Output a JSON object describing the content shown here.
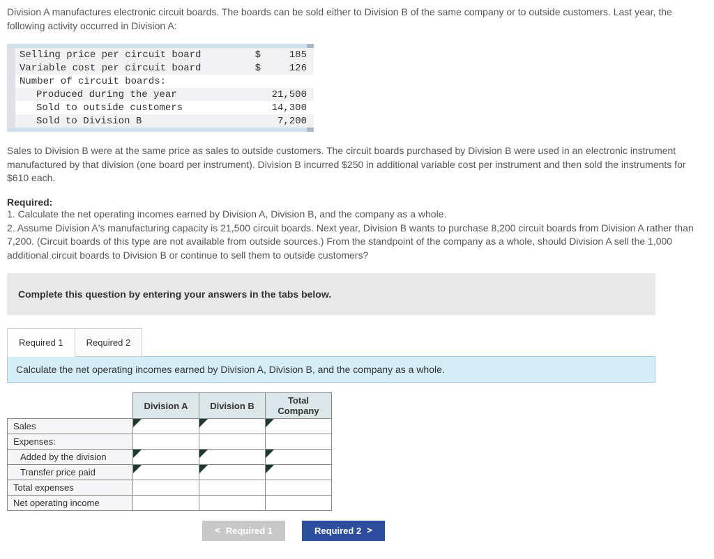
{
  "intro1": "Division A manufactures electronic circuit boards. The boards can be sold either to Division B of the same company or to outside customers. Last year, the following activity occurred in Division A:",
  "table": {
    "r1": {
      "label": "Selling price per circuit board",
      "cur": "$",
      "val": "185"
    },
    "r2": {
      "label": "Variable cost per circuit board",
      "cur": "$",
      "val": "126"
    },
    "r3": {
      "label": "Number of circuit boards:"
    },
    "r4": {
      "label": "Produced during the year",
      "val": "21,500"
    },
    "r5": {
      "label": "Sold to outside customers",
      "val": "14,300"
    },
    "r6": {
      "label": "Sold to Division B",
      "val": "7,200"
    }
  },
  "para2": "Sales to Division B were at the same price as sales to outside customers. The circuit boards purchased by Division B were used in an electronic instrument manufactured by that division (one board per instrument). Division B incurred $250 in additional variable cost per instrument and then sold the instruments for $610 each.",
  "required_label": "Required:",
  "req1": "1. Calculate the net operating incomes earned by Division A, Division B, and the company as a whole.",
  "req2": "2. Assume Division A's manufacturing capacity is 21,500 circuit boards. Next year, Division B wants to purchase 8,200 circuit boards from Division A rather than 7,200. (Circuit boards of this type are not available from outside sources.) From the standpoint of the company as a whole, should Division A sell the 1,000 additional circuit boards to Division B or continue to sell them to outside customers?",
  "instruction": "Complete this question by entering your answers in the tabs below.",
  "tabs": {
    "t1": "Required 1",
    "t2": "Required 2"
  },
  "tab_instruction": "Calculate the net operating incomes earned by Division A, Division B, and the company as a whole.",
  "cols": {
    "c1": "Division A",
    "c2": "Division B",
    "c3": "Total Company"
  },
  "rows": {
    "sales": "Sales",
    "expenses": "Expenses:",
    "added": "Added by the division",
    "transfer": "Transfer price paid",
    "total_exp": "Total expenses",
    "noi": "Net operating income"
  },
  "nav": {
    "prev": "Required 1",
    "next": "Required 2"
  }
}
